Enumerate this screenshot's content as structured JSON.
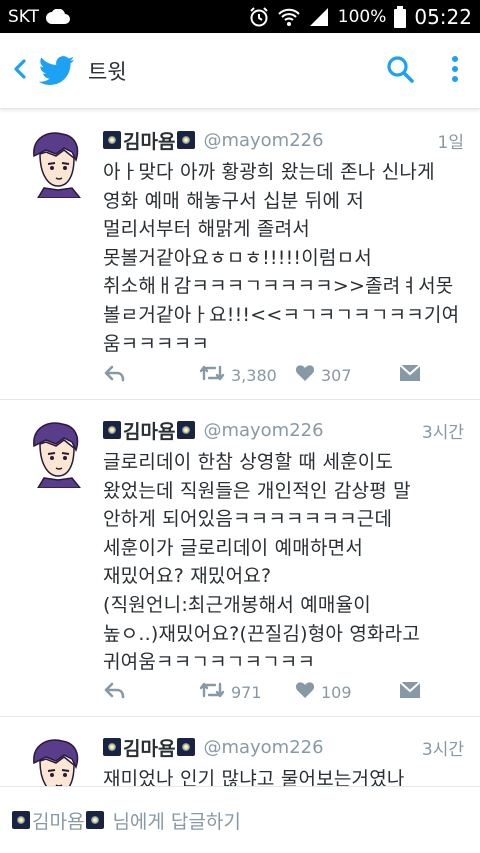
{
  "status_bar": {
    "carrier": "SKT",
    "battery": "100%",
    "time": "05:22"
  },
  "app_bar": {
    "title": "트윗"
  },
  "tweets": [
    {
      "name": "김마욤",
      "handle": "@mayom226",
      "time": "1일",
      "text": "아ㅏ맞다 아까 황광희 왔는데 존나 신나게\n영화 예매 해놓구서 십분 뒤에 저\n멀리서부터 해맑게 졸려서\n못볼거같아요ㅎㅁㅎ!!!!!이럼ㅁ서\n취소해ㅐ감ㅋㅋㅋㄱㅋㅋㅋㅋ>>졸려ㅕ서못\n볼ㄹ거같아ㅏ요!!!<<ㅋㄱㅋㄱㅋㄱㅋㅋ기여\n움ㅋㅋㅋㅋㅋ",
      "retweets": "3,380",
      "likes": "307"
    },
    {
      "name": "김마욤",
      "handle": "@mayom226",
      "time": "3시간",
      "text": "글로리데이 한참 상영할 때 세훈이도\n왔었는데 직원들은 개인적인 감상평 말\n안하게 되어있음ㅋㅋㅋㅋㅋㅋㅋ근데\n세훈이가 글로리데이 예매하면서\n재밌어요? 재밌어요?\n(직원언니:최근개봉해서 예매율이\n높ㅇ..)재밌어요?(끈질김)형아 영화라고\n귀여움ㅋㅋㄱㅋㄱㅋㄱㅋㅋ",
      "retweets": "971",
      "likes": "109"
    },
    {
      "name": "김마욤",
      "handle": "@mayom226",
      "time": "3시간",
      "text": "재미었나 인기 많냐고 물어보는거였나"
    }
  ],
  "reply_bar": {
    "name": "김마욤",
    "suffix": "님에게 답글하기"
  },
  "colors": {
    "accent": "#1da1f2",
    "secondary_text": "#8899a6",
    "primary_text": "#292f33"
  },
  "icons": [
    "back-arrow-icon",
    "twitter-bird-icon",
    "search-icon",
    "more-vertical-icon",
    "reply-icon",
    "retweet-icon",
    "heart-icon",
    "direct-message-icon"
  ]
}
